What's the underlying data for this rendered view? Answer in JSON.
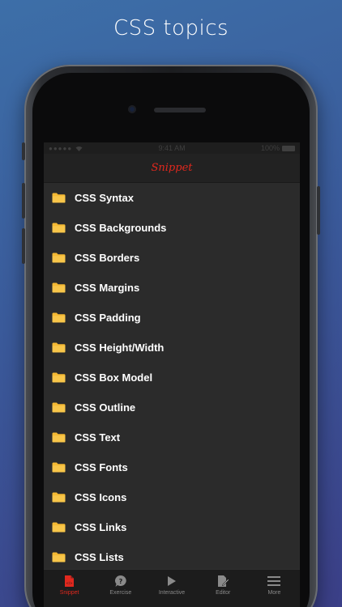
{
  "promo": {
    "title": "CSS topics"
  },
  "status_bar": {
    "time": "9:41 AM",
    "battery": "100%"
  },
  "nav": {
    "title": "Snippet"
  },
  "topics": [
    {
      "label": "CSS Syntax"
    },
    {
      "label": "CSS Backgrounds"
    },
    {
      "label": "CSS Borders"
    },
    {
      "label": "CSS Margins"
    },
    {
      "label": "CSS Padding"
    },
    {
      "label": "CSS Height/Width"
    },
    {
      "label": "CSS Box Model"
    },
    {
      "label": "CSS Outline"
    },
    {
      "label": "CSS Text"
    },
    {
      "label": "CSS Fonts"
    },
    {
      "label": "CSS Icons"
    },
    {
      "label": "CSS Links"
    },
    {
      "label": "CSS Lists"
    }
  ],
  "tabs": [
    {
      "label": "Snippet",
      "icon": "document-icon",
      "active": true
    },
    {
      "label": "Exercise",
      "icon": "question-icon",
      "active": false
    },
    {
      "label": "Interactive",
      "icon": "play-icon",
      "active": false
    },
    {
      "label": "Editor",
      "icon": "edit-icon",
      "active": false
    },
    {
      "label": "More",
      "icon": "menu-icon",
      "active": false
    }
  ],
  "colors": {
    "accent": "#e0281e",
    "folder": "#f5b933",
    "background_top": "#3d6fa8",
    "background_bottom": "#3b3f87"
  }
}
